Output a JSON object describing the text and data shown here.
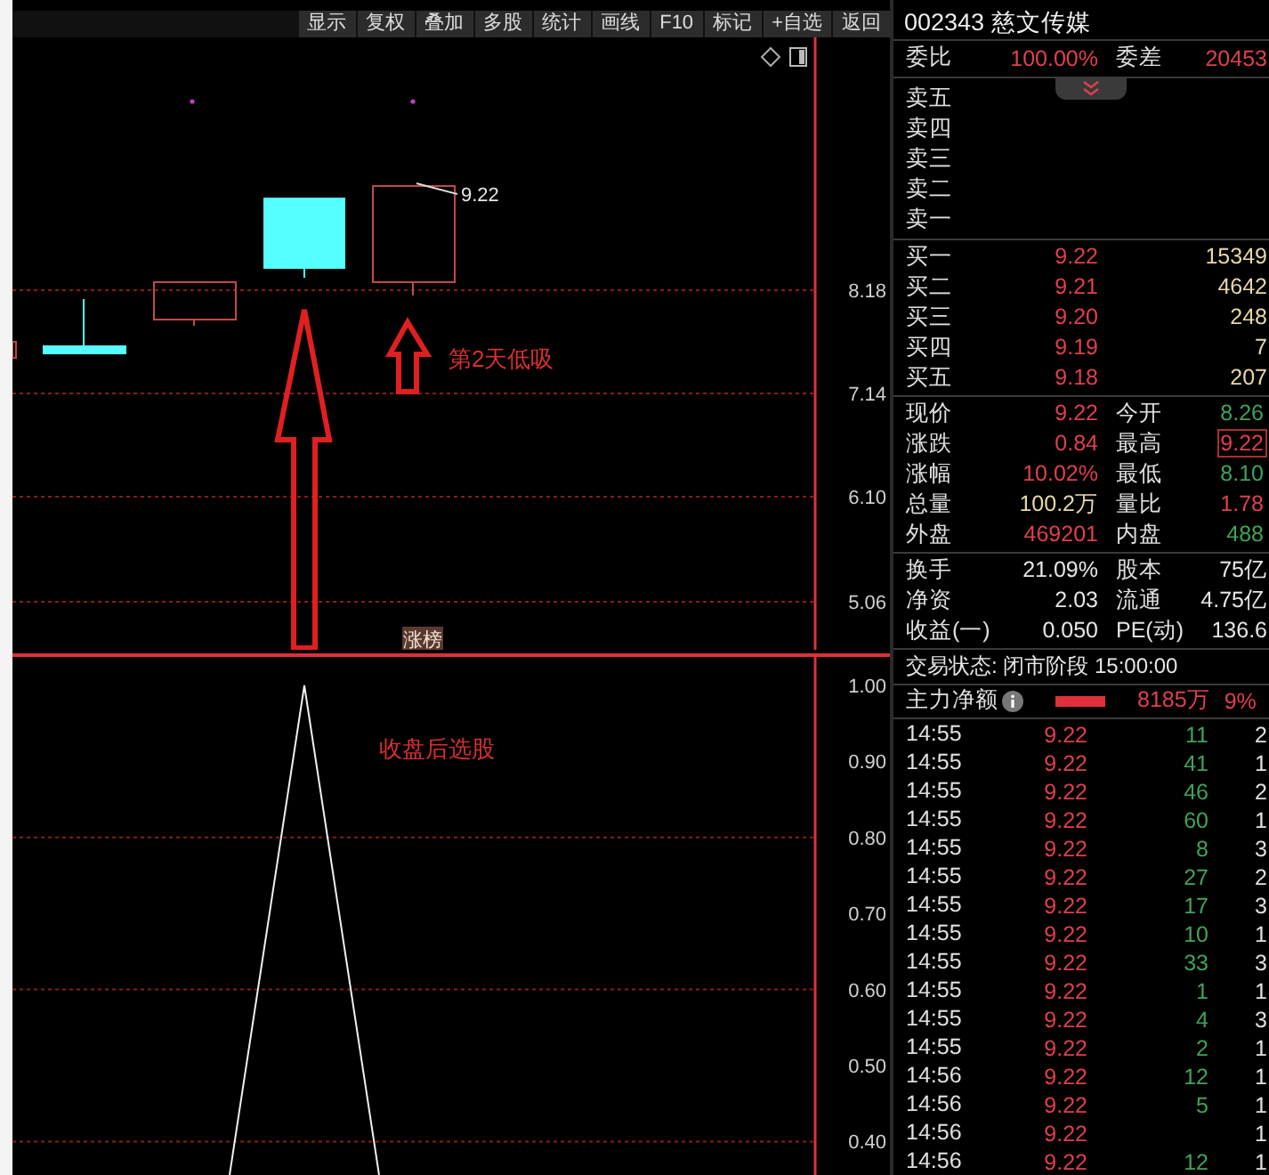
{
  "toolbar": {
    "buttons": [
      "显示",
      "复权",
      "叠加",
      "多股",
      "统计",
      "画线",
      "F10",
      "标记",
      "+自选",
      "返回"
    ]
  },
  "price_chart": {
    "ticks": [
      "8.18",
      "7.14",
      "6.10",
      "5.06"
    ],
    "high_label": "9.22",
    "annotation": "第2天低吸",
    "tag": "涨榜"
  },
  "indicator": {
    "annotation": "收盘后选股",
    "ticks": [
      "1.00",
      "0.90",
      "0.80",
      "0.70",
      "0.60",
      "0.50",
      "0.40"
    ]
  },
  "quote": {
    "code": "002343",
    "name": "慈文传媒",
    "ratio": {
      "label": "委比",
      "value": "100.00%",
      "label2": "委差",
      "value2": "20453"
    },
    "asks": [
      {
        "label": "卖五"
      },
      {
        "label": "卖四"
      },
      {
        "label": "卖三"
      },
      {
        "label": "卖二"
      },
      {
        "label": "卖一"
      }
    ],
    "bids": [
      {
        "label": "买一",
        "price": "9.22",
        "volume": "15349"
      },
      {
        "label": "买二",
        "price": "9.21",
        "volume": "4642"
      },
      {
        "label": "买三",
        "price": "9.20",
        "volume": "248"
      },
      {
        "label": "买四",
        "price": "9.19",
        "volume": "7"
      },
      {
        "label": "买五",
        "price": "9.18",
        "volume": "207"
      }
    ],
    "stats": [
      {
        "left": {
          "label": "现价",
          "value": "9.22",
          "color": "#e0404a"
        },
        "right": {
          "label": "今开",
          "value": "8.26",
          "color": "#3fa35a",
          "boxed": false
        }
      },
      {
        "left": {
          "label": "涨跌",
          "value": "0.84",
          "color": "#e0404a"
        },
        "right": {
          "label": "最高",
          "value": "9.22",
          "color": "#e0404a",
          "boxed": true
        }
      },
      {
        "left": {
          "label": "涨幅",
          "value": "10.02%",
          "color": "#e0404a"
        },
        "right": {
          "label": "最低",
          "value": "8.10",
          "color": "#3fa35a",
          "boxed": false
        }
      },
      {
        "left": {
          "label": "总量",
          "value": "100.2万",
          "color": "#e8d8a8"
        },
        "right": {
          "label": "量比",
          "value": "1.78",
          "color": "#e0404a",
          "boxed": false
        }
      },
      {
        "left": {
          "label": "外盘",
          "value": "469201",
          "color": "#e0404a"
        },
        "right": {
          "label": "内盘",
          "value": "488",
          "color": "#3fa35a",
          "boxed": false
        }
      }
    ],
    "fundamentals": [
      {
        "label": "换手",
        "value": "21.09%",
        "label2": "股本",
        "value2": "75亿"
      },
      {
        "label": "净资",
        "value": "2.03",
        "label2": "流通",
        "value2": "4.75亿"
      },
      {
        "label": "收益(一)",
        "value": "0.050",
        "label2": "PE(动)",
        "value2": "136.6"
      }
    ],
    "status": "交易状态: 闭市阶段 15:00:00",
    "main_flow": {
      "label": "主力净额",
      "value": "8185万",
      "share": "9%"
    },
    "trades": [
      {
        "time": "14:55",
        "price": "9.22",
        "volume": "11",
        "column_4": "2"
      },
      {
        "time": "14:55",
        "price": "9.22",
        "volume": "41",
        "column_4": "1"
      },
      {
        "time": "14:55",
        "price": "9.22",
        "volume": "46",
        "column_4": "2"
      },
      {
        "time": "14:55",
        "price": "9.22",
        "volume": "60",
        "column_4": "1"
      },
      {
        "time": "14:55",
        "price": "9.22",
        "volume": "8",
        "column_4": "3"
      },
      {
        "time": "14:55",
        "price": "9.22",
        "volume": "27",
        "column_4": "2"
      },
      {
        "time": "14:55",
        "price": "9.22",
        "volume": "17",
        "column_4": "3"
      },
      {
        "time": "14:55",
        "price": "9.22",
        "volume": "10",
        "column_4": "1"
      },
      {
        "time": "14:55",
        "price": "9.22",
        "volume": "33",
        "column_4": "3"
      },
      {
        "time": "14:55",
        "price": "9.22",
        "volume": "1",
        "column_4": "1"
      },
      {
        "time": "14:55",
        "price": "9.22",
        "volume": "4",
        "column_4": "3"
      },
      {
        "time": "14:55",
        "price": "9.22",
        "volume": "2",
        "column_4": "1"
      },
      {
        "time": "14:56",
        "price": "9.22",
        "volume": "12",
        "column_4": "1"
      },
      {
        "time": "14:56",
        "price": "9.22",
        "volume": "5",
        "column_4": "1"
      },
      {
        "time": "14:56",
        "price": "9.22",
        "column_4": "1"
      },
      {
        "time": "14:56",
        "price": "9.22",
        "volume": "12",
        "column_4": "1"
      }
    ]
  }
}
